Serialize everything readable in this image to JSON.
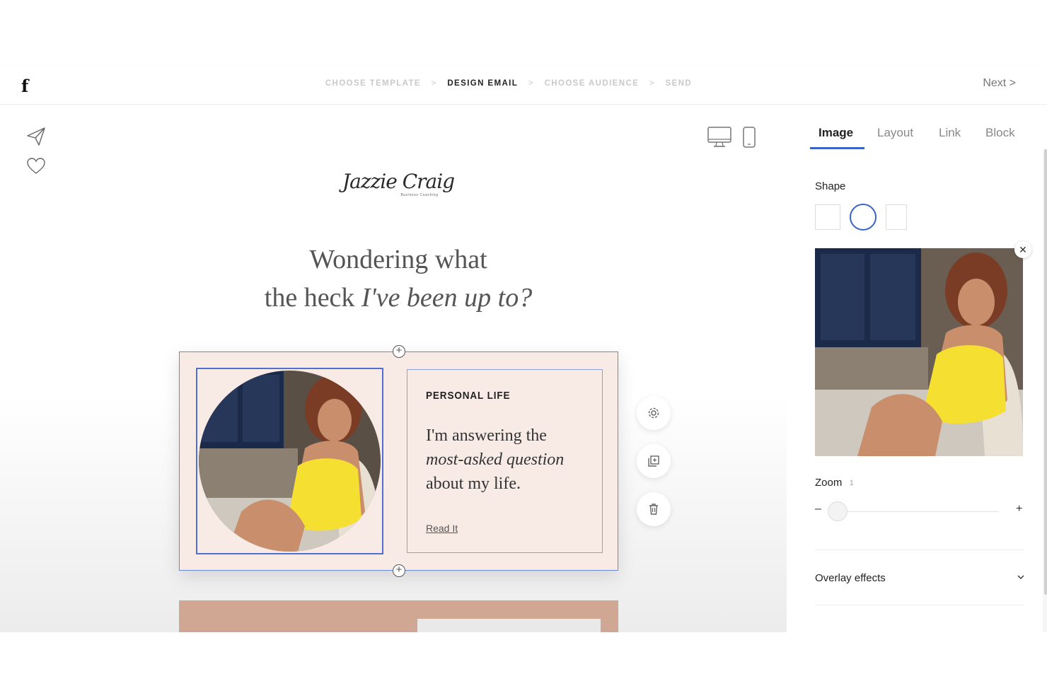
{
  "app": {
    "logo": "f",
    "steps": [
      "CHOOSE TEMPLATE",
      "DESIGN EMAIL",
      "CHOOSE AUDIENCE",
      "SEND"
    ],
    "active_step": "DESIGN EMAIL",
    "step_separator": ">",
    "next_label": "Next  >"
  },
  "sidebar_tools": [
    "send-icon",
    "heart-icon"
  ],
  "device_toggle": [
    "desktop-icon",
    "mobile-icon"
  ],
  "email": {
    "brand_name": "Jazzie Craig",
    "brand_tagline": "Business Coaching",
    "headline_line1": "Wondering what",
    "headline_line2_plain": "the heck ",
    "headline_line2_italic": "I've been up to?",
    "block": {
      "label": "PERSONAL LIFE",
      "body_line1": "I'm answering the",
      "body_line2_italic": "most-asked question",
      "body_line3": "about my life.",
      "link_label": "Read It"
    },
    "block_actions": [
      "settings-icon",
      "duplicate-icon",
      "trash-icon"
    ],
    "add_handle": "+"
  },
  "panel": {
    "tabs": [
      "Image",
      "Layout",
      "Link",
      "Block"
    ],
    "active_tab": "Image",
    "shape_label": "Shape",
    "shapes": [
      "square",
      "circle",
      "rectangle"
    ],
    "selected_shape": "circle",
    "remove_label": "✕",
    "zoom_label": "Zoom",
    "zoom_value": "1",
    "zoom_minus": "–",
    "zoom_plus": "+",
    "overlay_label": "Overlay effects"
  },
  "colors": {
    "accent": "#3a63c9",
    "block_bg": "#f8ebe6",
    "tank_top": "#f5e032"
  }
}
